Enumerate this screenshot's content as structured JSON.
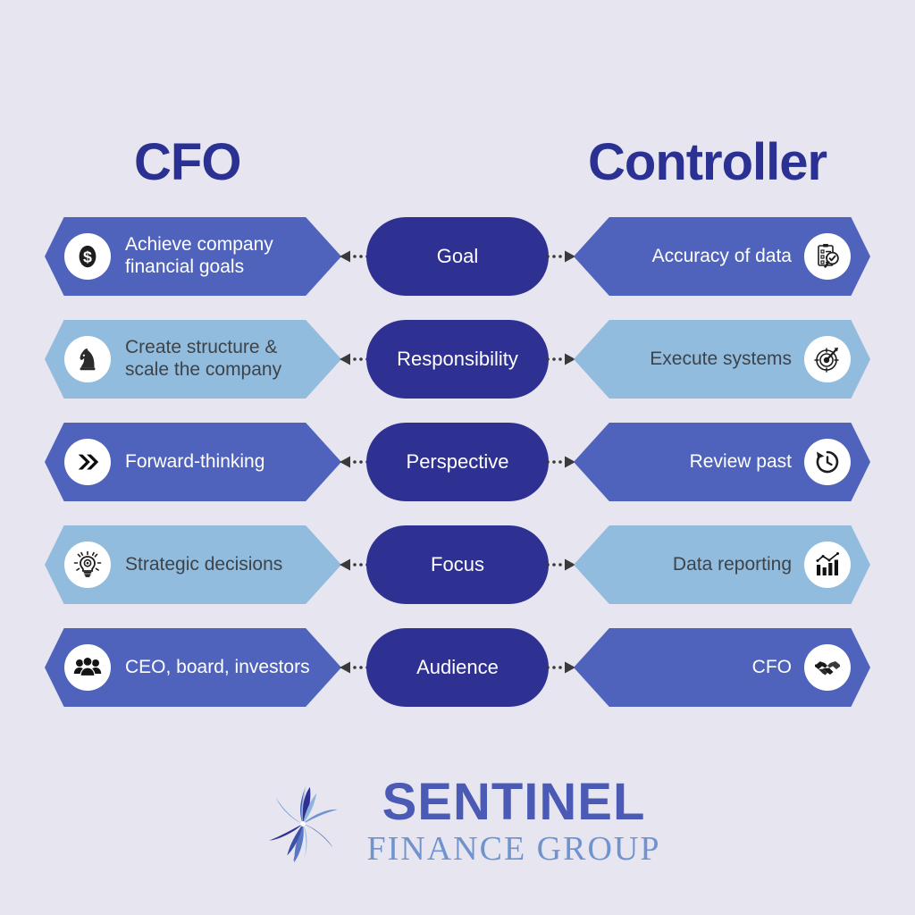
{
  "background_color": "#e6e5f0",
  "headings": {
    "left": "CFO",
    "right": "Controller",
    "color": "#2b3192"
  },
  "palette": {
    "navy": "#2e3192",
    "medium_blue": "#4f63bd",
    "light_blue": "#92bcdd",
    "dark_text": "#3e4349",
    "white": "#ffffff"
  },
  "rows": [
    {
      "category": "Goal",
      "left": {
        "label": "Achieve company\nfinancial goals",
        "icon": "dollar-sign-icon",
        "tone": "medium",
        "fill": "#4f63bd",
        "text_color": "#ffffff"
      },
      "right": {
        "label": "Accuracy of data",
        "icon": "clipboard-check-magnifier-icon",
        "tone": "medium",
        "fill": "#4f63bd",
        "text_color": "#ffffff"
      }
    },
    {
      "category": "Responsibility",
      "left": {
        "label": "Create structure &\nscale the company",
        "icon": "chess-knight-icon",
        "tone": "light",
        "fill": "#92bcdd",
        "text_color": "#3e4349"
      },
      "right": {
        "label": "Execute systems",
        "icon": "target-dart-icon",
        "tone": "light",
        "fill": "#92bcdd",
        "text_color": "#3e4349"
      }
    },
    {
      "category": "Perspective",
      "left": {
        "label": "Forward-thinking",
        "icon": "double-chevron-right-icon",
        "tone": "medium",
        "fill": "#4f63bd",
        "text_color": "#ffffff"
      },
      "right": {
        "label": "Review past",
        "icon": "clock-rewind-icon",
        "tone": "medium",
        "fill": "#4f63bd",
        "text_color": "#ffffff"
      }
    },
    {
      "category": "Focus",
      "left": {
        "label": "Strategic decisions",
        "icon": "lightbulb-gear-icon",
        "tone": "light",
        "fill": "#92bcdd",
        "text_color": "#3e4349"
      },
      "right": {
        "label": "Data reporting",
        "icon": "bar-chart-trend-icon",
        "tone": "light",
        "fill": "#92bcdd",
        "text_color": "#3e4349"
      }
    },
    {
      "category": "Audience",
      "left": {
        "label": "CEO, board, investors",
        "icon": "people-group-icon",
        "tone": "medium",
        "fill": "#4f63bd",
        "text_color": "#ffffff"
      },
      "right": {
        "label": "CFO",
        "icon": "handshake-icon",
        "tone": "medium",
        "fill": "#4f63bd",
        "text_color": "#ffffff"
      }
    }
  ],
  "logo": {
    "mark": "flower-burst-icon",
    "name": "SENTINEL",
    "subtitle": "FINANCE GROUP",
    "name_color": "#4a5ab5",
    "subtitle_color": "#6f93cf"
  }
}
